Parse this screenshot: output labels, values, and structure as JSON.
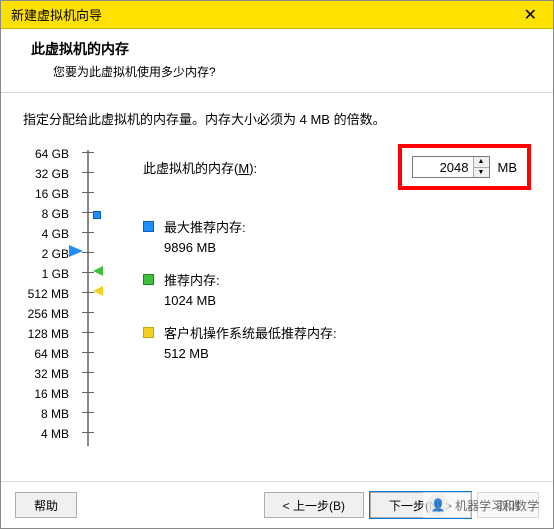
{
  "title": "新建虚拟机向导",
  "header": {
    "title": "此虚拟机的内存",
    "subtitle": "您要为此虚拟机使用多少内存?"
  },
  "instruction": "指定分配给此虚拟机的内存量。内存大小必须为 4 MB 的倍数。",
  "memory": {
    "label_prefix": "此虚拟机的内存(",
    "label_key": "M",
    "label_suffix": "):",
    "value": "2048",
    "unit": "MB"
  },
  "scale": [
    "64 GB",
    "32 GB",
    "16 GB",
    "8 GB",
    "4 GB",
    "2 GB",
    "1 GB",
    "512 MB",
    "256 MB",
    "128 MB",
    "64 MB",
    "32 MB",
    "16 MB",
    "8 MB",
    "4 MB"
  ],
  "recommendations": {
    "max": {
      "label": "最大推荐内存:",
      "value": "9896 MB"
    },
    "rec": {
      "label": "推荐内存:",
      "value": "1024 MB"
    },
    "min": {
      "label": "客户机操作系统最低推荐内存:",
      "value": "512 MB"
    }
  },
  "buttons": {
    "help": "帮助",
    "back": "< 上一步(B)",
    "next": "下一步(N) >",
    "cancel": "取消"
  },
  "watermark": "机器学习和数学",
  "colors": {
    "accent": "#ffe100",
    "highlight": "#ff0000"
  }
}
